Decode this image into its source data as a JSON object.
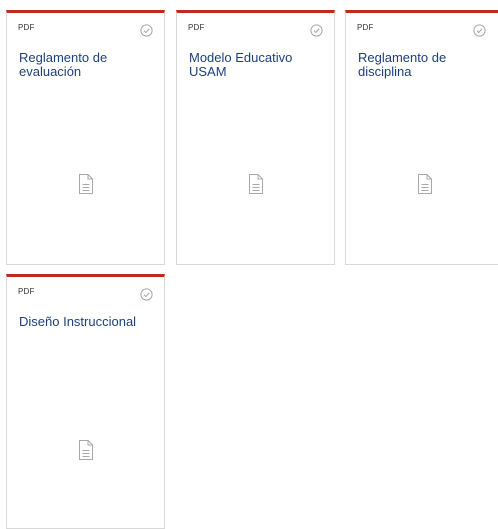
{
  "documents": [
    {
      "type": "PDF",
      "title": "Reglamento de evaluación",
      "icon": "document-icon",
      "status_icon": "check-circle-icon"
    },
    {
      "type": "PDF",
      "title": "Modelo Educativo USAM",
      "icon": "document-icon",
      "status_icon": "check-circle-icon"
    },
    {
      "type": "PDF",
      "title": "Reglamento de disciplina",
      "icon": "document-icon",
      "status_icon": "check-circle-icon"
    },
    {
      "type": "PDF",
      "title": "Diseño Instruccional",
      "icon": "document-icon",
      "status_icon": "check-circle-icon"
    }
  ],
  "colors": {
    "accent": "#c4291f",
    "title": "#1e3f7a",
    "border": "#d8d8d8",
    "icon": "#a8a8a8"
  }
}
